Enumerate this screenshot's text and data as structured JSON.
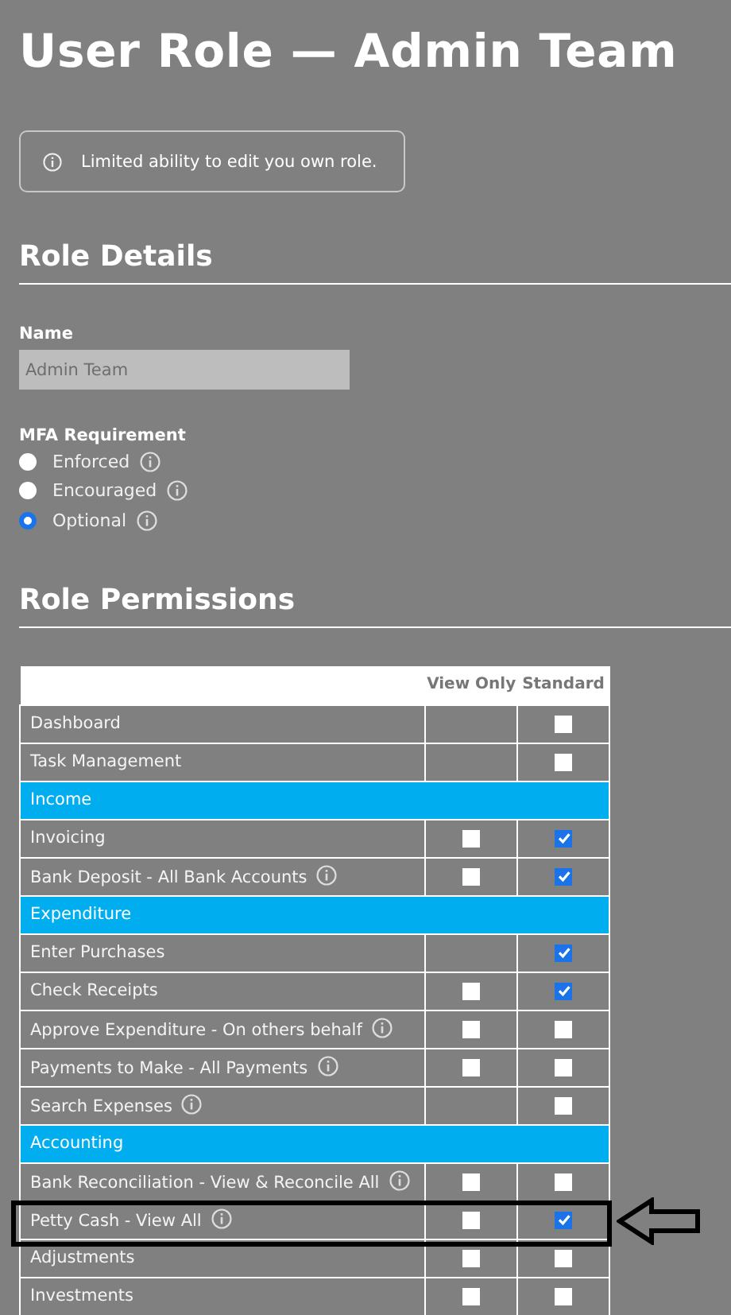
{
  "title": "User Role — Admin Team",
  "notice": {
    "text": "Limited ability to edit you own role."
  },
  "role_details": {
    "heading": "Role Details",
    "name_label": "Name",
    "name_placeholder": "Admin Team",
    "mfa_label": "MFA Requirement",
    "mfa_options": [
      {
        "label": "Enforced",
        "selected": false
      },
      {
        "label": "Encouraged",
        "selected": false
      },
      {
        "label": "Optional",
        "selected": true
      }
    ]
  },
  "permissions": {
    "heading": "Role Permissions",
    "columns": [
      "View Only",
      "Standard"
    ],
    "rows": [
      {
        "kind": "permission",
        "label": "Dashboard",
        "info": false,
        "standard": false
      },
      {
        "kind": "permission",
        "label": "Task Management",
        "info": false,
        "standard": false
      },
      {
        "kind": "section",
        "label": "Income"
      },
      {
        "kind": "permission",
        "label": "Invoicing",
        "info": false,
        "view_only": false,
        "standard": true
      },
      {
        "kind": "permission",
        "label": "Bank Deposit - All Bank Accounts",
        "info": true,
        "view_only": false,
        "standard": true
      },
      {
        "kind": "section",
        "label": "Expenditure"
      },
      {
        "kind": "permission",
        "label": "Enter Purchases",
        "info": false,
        "standard": true
      },
      {
        "kind": "permission",
        "label": "Check Receipts",
        "info": false,
        "view_only": false,
        "standard": true
      },
      {
        "kind": "permission",
        "label": "Approve Expenditure - On others behalf",
        "info": true,
        "view_only": false,
        "standard": false
      },
      {
        "kind": "permission",
        "label": "Payments to Make - All Payments",
        "info": true,
        "view_only": false,
        "standard": false
      },
      {
        "kind": "permission",
        "label": "Search Expenses",
        "info": true,
        "standard": false
      },
      {
        "kind": "section",
        "label": "Accounting"
      },
      {
        "kind": "permission",
        "label": "Bank Reconciliation - View & Reconcile All",
        "info": true,
        "view_only": false,
        "standard": false
      },
      {
        "kind": "permission",
        "label": "Petty Cash - View All",
        "info": true,
        "view_only": false,
        "standard": true,
        "highlighted": true
      },
      {
        "kind": "permission",
        "label": "Adjustments",
        "info": false,
        "view_only": false,
        "standard": false
      },
      {
        "kind": "permission",
        "label": "Investments",
        "info": false,
        "view_only": false,
        "standard": false
      }
    ]
  }
}
